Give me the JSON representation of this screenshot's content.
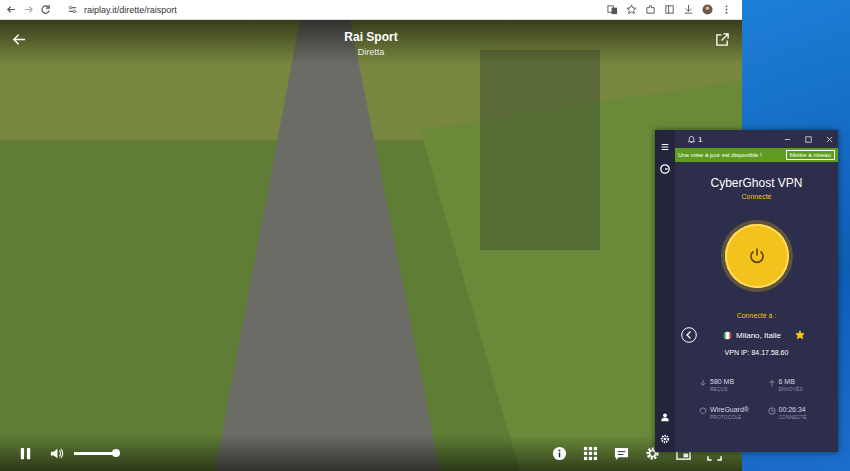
{
  "browser": {
    "url": "raiplay.it/dirette/raisport"
  },
  "player": {
    "title": "Rai Sport",
    "subtitle": "Diretta",
    "playing": true,
    "volume": {
      "level": 1.0
    }
  },
  "vpn": {
    "notifications": "1",
    "banner": {
      "text": "Une mise à jour est disponible !",
      "button": "Mettre à niveau"
    },
    "title": "CyberGhost VPN",
    "status": "Connecté",
    "connected": true,
    "connected_to_label": "Connecté à :",
    "location": "Milano, Italie",
    "favorite": true,
    "ip": "VPN IP: 84.17.58.60",
    "stats": [
      {
        "kind": "down",
        "value": "580 MB",
        "label": "REÇUS"
      },
      {
        "kind": "up",
        "value": "6 MB",
        "label": "ENVOYÉS"
      },
      {
        "kind": "protocol",
        "value": "WireGuard®",
        "label": "PROTOCOLE"
      },
      {
        "kind": "time",
        "value": "00:26:34",
        "label": "CONNECTÉ"
      }
    ]
  }
}
